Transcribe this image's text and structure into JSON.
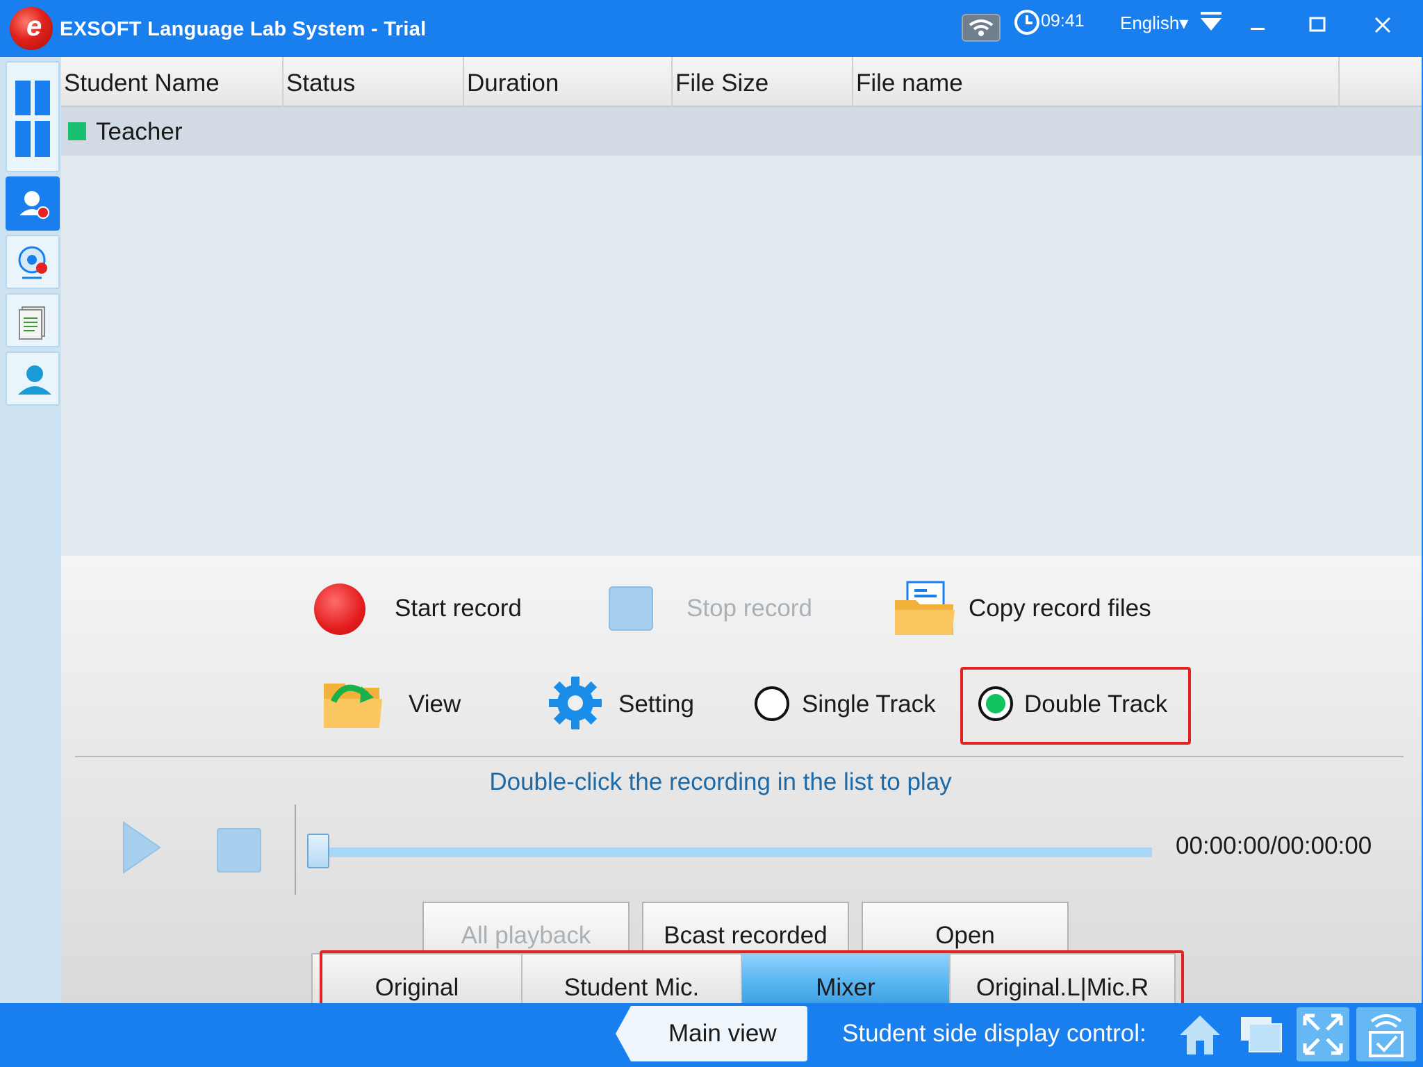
{
  "window": {
    "title": "EXSOFT Language Lab System - Trial",
    "time": "09:41",
    "language": "English▾"
  },
  "table": {
    "columns": [
      "Student Name",
      "Status",
      "Duration",
      "File Size",
      "File name"
    ],
    "rows": [
      {
        "student_name": "Teacher",
        "status_color": "#19c06f"
      }
    ]
  },
  "record": {
    "start_label": "Start record",
    "stop_label": "Stop record",
    "copy_label": "Copy record files",
    "view_label": "View",
    "setting_label": "Setting",
    "single_track_label": "Single Track",
    "double_track_label": "Double Track",
    "selected_track": "Double Track"
  },
  "player": {
    "hint": "Double-click the recording in the list to play",
    "time_display": "00:00:00/00:00:00",
    "progress": 0
  },
  "buttons": {
    "all_playback": "All playback",
    "bcast_recorded": "Bcast recorded",
    "open": "Open"
  },
  "modes": {
    "options": [
      "Original",
      "Student Mic.",
      "Mixer",
      "Original.L|Mic.R"
    ],
    "selected": "Mixer"
  },
  "bottom": {
    "main_view": "Main view",
    "display_control": "Student side display control:"
  },
  "colors": {
    "accent": "#1a7fee",
    "highlight": "#e52222",
    "status_green": "#19c06f"
  }
}
